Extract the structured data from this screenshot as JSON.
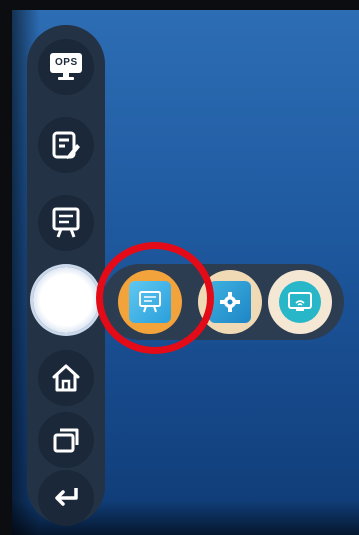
{
  "sidebar": {
    "items": [
      {
        "name": "ops",
        "label": "OPS",
        "icon": "ops-monitor-icon"
      },
      {
        "name": "note",
        "label": "",
        "icon": "note-pencil-icon"
      },
      {
        "name": "whiteboard",
        "label": "",
        "icon": "whiteboard-icon"
      },
      {
        "name": "menu-center",
        "label": "",
        "icon": "circle-menu-icon"
      },
      {
        "name": "home",
        "label": "",
        "icon": "home-icon"
      },
      {
        "name": "multitask",
        "label": "",
        "icon": "windows-stack-icon"
      },
      {
        "name": "back",
        "label": "",
        "icon": "back-arrow-icon"
      }
    ]
  },
  "submenu": {
    "items": [
      {
        "name": "whiteboard-app",
        "icon": "whiteboard-app-icon",
        "selected": true
      },
      {
        "name": "settings-app",
        "icon": "gear-app-icon",
        "selected": false
      },
      {
        "name": "screen-share-app",
        "icon": "wireless-display-icon",
        "selected": false
      }
    ]
  },
  "annotation": {
    "highlight": "red-circle-highlight",
    "color": "#e30b17"
  },
  "colors": {
    "sidebar_bg": "#233245",
    "button_bg": "#1b2839",
    "icon_white": "#ffffff",
    "orange": "#f3a33c",
    "cream": "#f4e7d4",
    "teal": "#28b6c9"
  }
}
